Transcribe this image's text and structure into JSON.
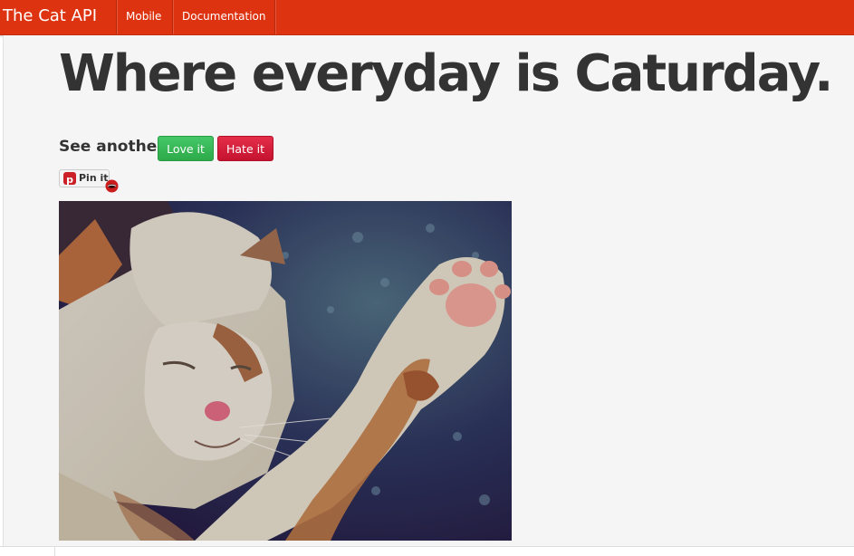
{
  "navbar": {
    "brand": "The Cat API",
    "items": [
      {
        "label": "Mobile"
      },
      {
        "label": "Documentation"
      }
    ]
  },
  "hero": {
    "title": "Where everyday is Caturday."
  },
  "vote": {
    "prompt": "See another?",
    "love_label": "Love it",
    "hate_label": "Hate it"
  },
  "pinterest": {
    "label": "Pin it",
    "icon": "pinterest-icon"
  },
  "badge_icon": "lips-icon",
  "photo": {
    "alt": "cat photo",
    "icon": "cat-image"
  },
  "colors": {
    "navbar": "#dd3311",
    "love": "#35b555",
    "hate": "#d41c3a",
    "title": "#333333",
    "page_bg": "#f5f5f5"
  }
}
